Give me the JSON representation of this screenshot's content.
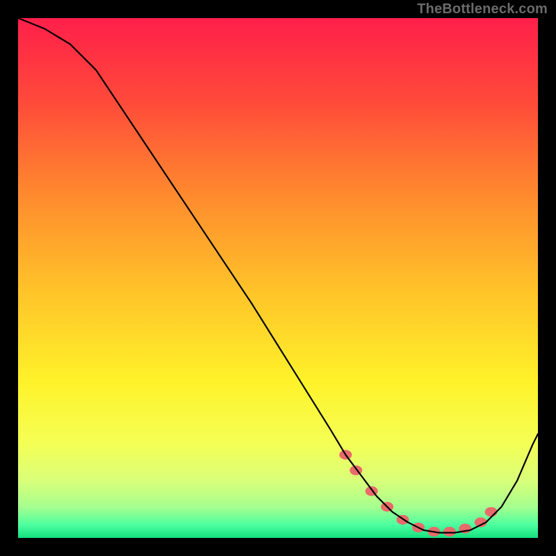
{
  "watermark": "TheBottleneck.com",
  "chart_data": {
    "type": "line",
    "title": "",
    "xlabel": "",
    "ylabel": "",
    "xlim": [
      0,
      100
    ],
    "ylim": [
      0,
      100
    ],
    "grid": false,
    "series": [
      {
        "name": "curve",
        "x": [
          0,
          5,
          10,
          15,
          20,
          25,
          30,
          35,
          40,
          45,
          50,
          55,
          60,
          63,
          66,
          69,
          72,
          75,
          78,
          81,
          84,
          87,
          90,
          93,
          96,
          99,
          100
        ],
        "y": [
          100,
          98,
          95,
          90,
          82.5,
          75,
          67.5,
          60,
          52.5,
          45,
          37,
          29,
          21,
          16,
          12,
          8,
          5,
          3,
          1.5,
          1,
          1,
          1.5,
          3,
          6,
          11,
          18,
          20
        ]
      }
    ],
    "markers": [
      {
        "x": 63,
        "y": 16
      },
      {
        "x": 65,
        "y": 13
      },
      {
        "x": 68,
        "y": 9
      },
      {
        "x": 71,
        "y": 6
      },
      {
        "x": 74,
        "y": 3.5
      },
      {
        "x": 77,
        "y": 2
      },
      {
        "x": 80,
        "y": 1.2
      },
      {
        "x": 83,
        "y": 1.2
      },
      {
        "x": 86,
        "y": 1.8
      },
      {
        "x": 89,
        "y": 3
      },
      {
        "x": 91,
        "y": 5
      }
    ],
    "background_gradient": {
      "type": "vertical",
      "stops": [
        {
          "pos": 0.0,
          "color": "#ff1f4a"
        },
        {
          "pos": 0.16,
          "color": "#ff4a3a"
        },
        {
          "pos": 0.34,
          "color": "#ff8a2e"
        },
        {
          "pos": 0.52,
          "color": "#ffc229"
        },
        {
          "pos": 0.7,
          "color": "#fff22a"
        },
        {
          "pos": 0.82,
          "color": "#f4ff55"
        },
        {
          "pos": 0.89,
          "color": "#d9ff7a"
        },
        {
          "pos": 0.94,
          "color": "#a6ff8e"
        },
        {
          "pos": 0.975,
          "color": "#4dffa0"
        },
        {
          "pos": 1.0,
          "color": "#14e07f"
        }
      ]
    },
    "marker_style": {
      "fill": "#e86a6a",
      "rx": 9,
      "ry": 7
    },
    "curve_style": {
      "stroke": "#000000",
      "width": 2.2
    }
  }
}
